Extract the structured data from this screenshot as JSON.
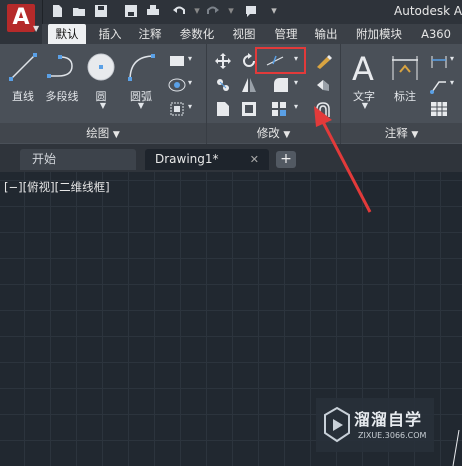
{
  "app": {
    "logo_letter": "A",
    "title": "Autodesk Aut"
  },
  "ribbon_tabs": [
    "默认",
    "插入",
    "注释",
    "参数化",
    "视图",
    "管理",
    "输出",
    "附加模块",
    "A360"
  ],
  "panels": {
    "draw": {
      "title": "绘图",
      "tools": {
        "line": "直线",
        "polyline": "多段线",
        "circle": "圆",
        "arc": "圆弧"
      }
    },
    "modify": {
      "title": "修改"
    },
    "annotation": {
      "title": "注释",
      "tools": {
        "text": "文字",
        "dimension": "标注"
      }
    }
  },
  "doc_tabs": {
    "start": "开始",
    "drawing": "Drawing1*"
  },
  "viewport": {
    "label": "[−][俯视][二维线框]"
  },
  "watermark": {
    "title": "溜溜自学",
    "subtitle": "ZIXUE.3066.COM"
  },
  "colors": {
    "accent_red": "#e23a3a",
    "logo_red": "#b52a2a",
    "canvas": "#212830",
    "ribbon": "#4a5058"
  },
  "icons": [
    "new-icon",
    "open-icon",
    "save-icon",
    "saveas-icon",
    "print-icon",
    "undo-icon",
    "redo-icon",
    "move-icon",
    "rotate-icon",
    "trim-icon",
    "erase-icon",
    "copy-icon",
    "mirror-icon",
    "fillet-icon",
    "explode-icon",
    "stretch-icon",
    "scale-icon",
    "array-icon",
    "offset-icon",
    "table-icon",
    "leader-icon"
  ]
}
